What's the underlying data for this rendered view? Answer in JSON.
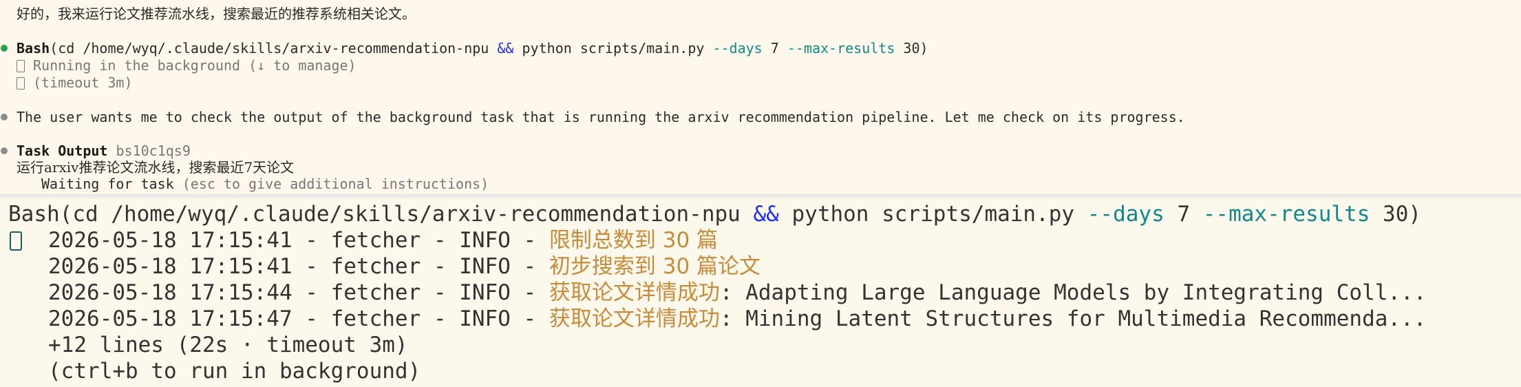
{
  "top": {
    "intro": "好的，我来运行论文推荐流水线，搜索最近的推荐系统相关论文。",
    "bash": {
      "label": "Bash",
      "cmd_start": "(cd /home/wyq/.claude/skills/arxiv-recommendation-npu ",
      "and": "&&",
      "cmd_mid": " python scripts/main.py ",
      "flag_days": "--days",
      "days_value": " 7 ",
      "flag_max": "--max-results",
      "max_value": " 30)",
      "status_running": "Running in the background (↓ to manage)",
      "status_timeout": "(timeout 3m)"
    },
    "thought": "The user wants me to check the output of the background task that is running the arxiv recommendation pipeline. Let me check on its progress.",
    "task_output": {
      "label": "Task Output",
      "task_id": "bs10c1qs9",
      "description": "运行arxiv推荐论文流水线，搜索最近7天论文",
      "waiting_label": "Waiting for task",
      "waiting_hint": "(esc to give additional instructions)"
    }
  },
  "bottom": {
    "bash": {
      "label": "Bash",
      "cmd_start": "(cd /home/wyq/.claude/skills/arxiv-recommendation-npu ",
      "and": "&&",
      "cmd_mid": " python scripts/main.py ",
      "flag_days": "--days",
      "days_value": " 7 ",
      "flag_max": "--max-results",
      "max_value": " 30)"
    },
    "logs": [
      {
        "prefix": "2026-05-18 17:15:41 - fetcher - INFO - ",
        "message": "限制总数到 30 篇",
        "detail": ""
      },
      {
        "prefix": "2026-05-18 17:15:41 - fetcher - INFO - ",
        "message": "初步搜索到 30 篇论文",
        "detail": ""
      },
      {
        "prefix": "2026-05-18 17:15:44 - fetcher - INFO - ",
        "message": "获取论文详情成功",
        "detail": ": Adapting Large Language Models by Integrating Coll..."
      },
      {
        "prefix": "2026-05-18 17:15:47 - fetcher - INFO - ",
        "message": "获取论文详情成功",
        "detail": ": Mining Latent Structures for Multimedia Recommenda..."
      }
    ],
    "more_lines": "+12 lines (22s · timeout 3m)",
    "ctrl_hint": "(ctrl+b to run in background)"
  },
  "colors": {
    "background": "#fdf8ec",
    "bullet_green": "#22a34a",
    "bullet_gray": "#8c8c8c",
    "and_operator": "#1a2cff",
    "flag": "#0e8a8a",
    "log_message": "#c98a3a"
  },
  "icons": [
    "status-bullet-icon",
    "status-box-icon",
    "output-box-icon"
  ]
}
